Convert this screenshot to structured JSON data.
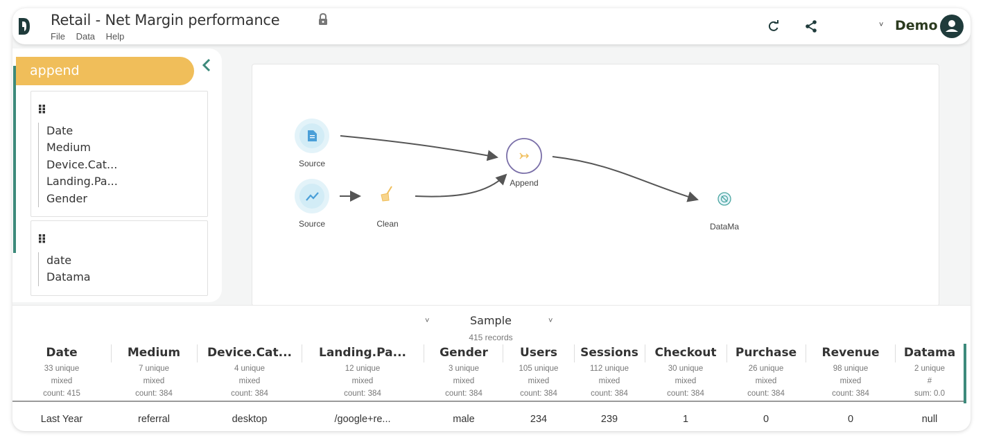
{
  "app": {
    "title": "Retail - Net Margin performance",
    "menu": [
      "File",
      "Data",
      "Help"
    ],
    "user": "Demo",
    "colors": {
      "accent": "#3d8a7b",
      "pill": "#f0be5a",
      "logo": "#1f3b3b"
    }
  },
  "panel": {
    "step": "append",
    "cards": [
      {
        "fields": [
          "Date",
          "Medium",
          "Device.Cat...",
          "Landing.Pa...",
          "Gender"
        ]
      },
      {
        "fields": [
          "date",
          "Datama"
        ]
      }
    ]
  },
  "flow": {
    "nodes": [
      {
        "id": "source1",
        "label": "Source",
        "icon": "document-icon"
      },
      {
        "id": "source2",
        "label": "Source",
        "icon": "trend-chart-icon"
      },
      {
        "id": "clean",
        "label": "Clean",
        "icon": "broom-icon"
      },
      {
        "id": "append",
        "label": "Append",
        "icon": "merge-arrow-icon"
      },
      {
        "id": "datama",
        "label": "DataMa",
        "icon": "datama-icon"
      }
    ]
  },
  "sample": {
    "label": "Sample",
    "records": "415 records",
    "columns": [
      {
        "name": "Date",
        "unique": "33 unique",
        "type": "mixed",
        "stat": "count: 415",
        "value": "Last Year"
      },
      {
        "name": "Medium",
        "unique": "7 unique",
        "type": "mixed",
        "stat": "count: 384",
        "value": "referral"
      },
      {
        "name": "Device.Cat...",
        "unique": "4 unique",
        "type": "mixed",
        "stat": "count: 384",
        "value": "desktop"
      },
      {
        "name": "Landing.Pa...",
        "unique": "12 unique",
        "type": "mixed",
        "stat": "count: 384",
        "value": "/google+re..."
      },
      {
        "name": "Gender",
        "unique": "3 unique",
        "type": "mixed",
        "stat": "count: 384",
        "value": "male"
      },
      {
        "name": "Users",
        "unique": "105 unique",
        "type": "mixed",
        "stat": "count: 384",
        "value": "234"
      },
      {
        "name": "Sessions",
        "unique": "112 unique",
        "type": "mixed",
        "stat": "count: 384",
        "value": "239"
      },
      {
        "name": "Checkout",
        "unique": "30 unique",
        "type": "mixed",
        "stat": "count: 384",
        "value": "1"
      },
      {
        "name": "Purchase",
        "unique": "26 unique",
        "type": "mixed",
        "stat": "count: 384",
        "value": "0"
      },
      {
        "name": "Revenue",
        "unique": "98 unique",
        "type": "mixed",
        "stat": "count: 384",
        "value": "0"
      },
      {
        "name": "Datama",
        "unique": "2 unique",
        "type": "#",
        "stat": "sum: 0.0",
        "value": "null"
      }
    ]
  }
}
